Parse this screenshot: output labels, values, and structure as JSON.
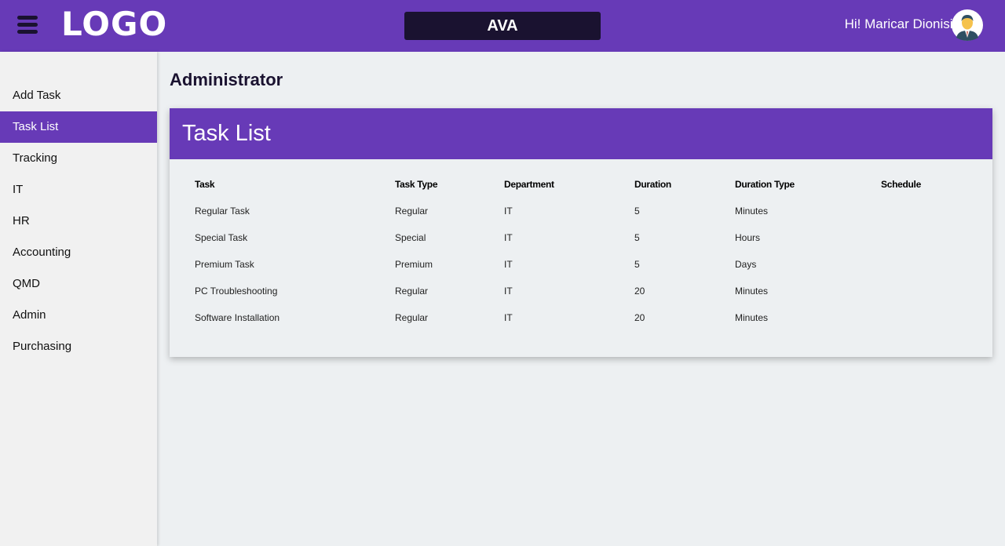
{
  "header": {
    "logo": "LOGO",
    "app_name": "AVA",
    "greeting": "Hi! Maricar Dionisio",
    "brand_color": "#673ab7",
    "dark_color": "#1a1230"
  },
  "sidebar": {
    "items": [
      {
        "label": "Add Task"
      },
      {
        "label": "Task List"
      },
      {
        "label": "Tracking"
      },
      {
        "label": "IT"
      },
      {
        "label": "HR"
      },
      {
        "label": "Accounting"
      },
      {
        "label": "QMD"
      },
      {
        "label": "Admin"
      },
      {
        "label": "Purchasing"
      }
    ],
    "active_index": 1
  },
  "main": {
    "page_title": "Administrator",
    "card_title": "Task List",
    "table": {
      "columns": [
        "Task",
        "Task Type",
        "Department",
        "Duration",
        "Duration Type",
        "Schedule"
      ],
      "rows": [
        [
          "Regular Task",
          "Regular",
          "IT",
          "5",
          "Minutes",
          ""
        ],
        [
          "Special Task",
          "Special",
          "IT",
          "5",
          "Hours",
          ""
        ],
        [
          "Premium Task",
          "Premium",
          "IT",
          "5",
          "Days",
          ""
        ],
        [
          "PC Troubleshooting",
          "Regular",
          "IT",
          "20",
          "Minutes",
          ""
        ],
        [
          "Software Installation",
          "Regular",
          "IT",
          "20",
          "Minutes",
          ""
        ]
      ]
    }
  }
}
